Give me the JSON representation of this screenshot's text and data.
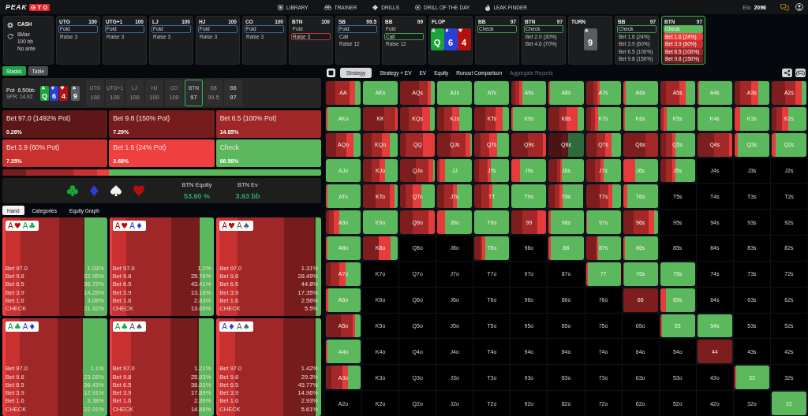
{
  "nav": {
    "logo": {
      "text": "PEAK",
      "badge": "GTO"
    },
    "links": [
      {
        "label": "LIBRARY"
      },
      {
        "label": "TRAINER"
      },
      {
        "label": "DRILLS"
      },
      {
        "label": "DRILL OF THE DAY"
      },
      {
        "label": "LEAK FINDER"
      }
    ],
    "elo": {
      "label": "Elo",
      "value": "2096"
    }
  },
  "game_info": {
    "format": "CASH",
    "details": [
      "8Max",
      "100 bb",
      "No ante"
    ]
  },
  "action_strip": [
    {
      "kind": "player",
      "position": "UTG",
      "stack": "100",
      "current": false,
      "actions": [
        {
          "label": "Fold",
          "selected": true,
          "color": "#3c6ea6"
        },
        {
          "label": "Raise 3",
          "selected": false
        }
      ]
    },
    {
      "kind": "player",
      "position": "UTG+1",
      "stack": "100",
      "current": false,
      "actions": [
        {
          "label": "Fold",
          "selected": true,
          "color": "#3c6ea6"
        },
        {
          "label": "Raise 3",
          "selected": false
        }
      ]
    },
    {
      "kind": "player",
      "position": "LJ",
      "stack": "100",
      "current": false,
      "actions": [
        {
          "label": "Fold",
          "selected": true,
          "color": "#3c6ea6"
        },
        {
          "label": "Raise 3",
          "selected": false
        }
      ]
    },
    {
      "kind": "player",
      "position": "HJ",
      "stack": "100",
      "current": false,
      "actions": [
        {
          "label": "Fold",
          "selected": true,
          "color": "#3c6ea6"
        },
        {
          "label": "Raise 3",
          "selected": false
        }
      ]
    },
    {
      "kind": "player",
      "position": "CO",
      "stack": "100",
      "current": false,
      "actions": [
        {
          "label": "Fold",
          "selected": true,
          "color": "#3c6ea6"
        },
        {
          "label": "Raise 3",
          "selected": false
        }
      ]
    },
    {
      "kind": "player",
      "position": "BTN",
      "stack": "100",
      "current": false,
      "actions": [
        {
          "label": "Fold",
          "selected": false
        },
        {
          "label": "Raise 3",
          "selected": true,
          "color": "#c23434"
        }
      ]
    },
    {
      "kind": "player",
      "position": "SB",
      "stack": "99.5",
      "current": false,
      "actions": [
        {
          "label": "Fold",
          "selected": true,
          "color": "#3c6ea6"
        },
        {
          "label": "Call",
          "selected": false
        },
        {
          "label": "Raise 12",
          "selected": false
        }
      ]
    },
    {
      "kind": "player",
      "position": "BB",
      "stack": "99",
      "current": false,
      "actions": [
        {
          "label": "Fold",
          "selected": false
        },
        {
          "label": "Call",
          "selected": true,
          "color": "#3aa34a"
        },
        {
          "label": "Raise 12",
          "selected": false
        }
      ]
    },
    {
      "kind": "street",
      "street": "FLOP",
      "cards": [
        {
          "rank": "Q",
          "suit": "♣",
          "color": "#1aa53a"
        },
        {
          "rank": "6",
          "suit": "♦",
          "color": "#2a3fd4"
        },
        {
          "rank": "4",
          "suit": "♥",
          "color": "#b30f0f"
        }
      ]
    },
    {
      "kind": "player",
      "position": "BB",
      "stack": "97",
      "current": false,
      "actions": [
        {
          "label": "Check",
          "selected": true,
          "color": "#3aa34a"
        }
      ]
    },
    {
      "kind": "player",
      "position": "BTN",
      "stack": "97",
      "current": false,
      "actions": [
        {
          "label": "Check",
          "selected": true,
          "color": "#3aa34a"
        },
        {
          "label": "Bet 2.0 (30%)",
          "selected": false
        },
        {
          "label": "Bet 4.6 (70%)",
          "selected": false
        }
      ]
    },
    {
      "kind": "street",
      "street": "TURN",
      "cards": [
        {
          "rank": "9",
          "suit": "♠",
          "color": "#5a5e63"
        }
      ]
    },
    {
      "kind": "player",
      "position": "BB",
      "stack": "97",
      "current": false,
      "actions": [
        {
          "label": "Check",
          "selected": true,
          "color": "#3aa34a"
        },
        {
          "label": "Bet 1.6 (24%)",
          "selected": false
        },
        {
          "label": "Bet 3.9 (60%)",
          "selected": false
        },
        {
          "label": "Bet 6.5 (100%)",
          "selected": false
        },
        {
          "label": "Bet 9.8 (150%)",
          "selected": false
        }
      ]
    },
    {
      "kind": "player",
      "position": "BTN",
      "stack": "97",
      "current": true,
      "actions": [
        {
          "label": "Check",
          "selected": false,
          "color": "#5cb85c"
        },
        {
          "label": "Bet 1.6 (24%)",
          "selected": false,
          "color": "#ef3f3f"
        },
        {
          "label": "Bet 3.9 (60%)",
          "selected": false,
          "color": "#c93131"
        },
        {
          "label": "Bet 6.5 (100%)",
          "selected": false,
          "color": "#a02727"
        },
        {
          "label": "Bet 9.8 (150%)",
          "selected": false,
          "color": "#7a1c1c"
        }
      ]
    }
  ],
  "panel_tabs": [
    {
      "label": "Stacks",
      "selected": true
    },
    {
      "label": "Table",
      "selected": false
    }
  ],
  "pot": {
    "label": "Pot",
    "value": "6.50bb",
    "spr": "SPR: 14.92",
    "board": [
      {
        "rank": "Q",
        "suit": "♣",
        "color": "#1aa53a"
      },
      {
        "rank": "6",
        "suit": "♦",
        "color": "#2a3fd4"
      },
      {
        "rank": "4",
        "suit": "♥",
        "color": "#b30f0f"
      },
      {
        "rank": "9",
        "suit": "♠",
        "color": "#5a5e63"
      }
    ],
    "seats": [
      {
        "position": "UTG",
        "stack": "100",
        "folded": true,
        "selected": false
      },
      {
        "position": "UTG+1",
        "stack": "100",
        "folded": true,
        "selected": false
      },
      {
        "position": "LJ",
        "stack": "100",
        "folded": true,
        "selected": false
      },
      {
        "position": "HJ",
        "stack": "100",
        "folded": true,
        "selected": false
      },
      {
        "position": "CO",
        "stack": "100",
        "folded": true,
        "selected": false
      },
      {
        "position": "BTN",
        "stack": "97",
        "folded": false,
        "selected": true
      },
      {
        "position": "SB",
        "stack": "99.5",
        "folded": true,
        "selected": false
      },
      {
        "position": "BB",
        "stack": "97",
        "folded": false,
        "selected": false
      }
    ]
  },
  "strategy": {
    "actions": [
      {
        "label": "Bet 97.0 (1492% Pot)",
        "frequency": "0.26%",
        "color": "#5e1717"
      },
      {
        "label": "Bet 9.8 (150% Pot)",
        "frequency": "7.29%",
        "color": "#771c1c"
      },
      {
        "label": "Bet 6.5 (100% Pot)",
        "frequency": "14.85%",
        "color": "#a02727"
      },
      {
        "label": "Bet 3.9 (60% Pot)",
        "frequency": "7.35%",
        "color": "#c93131"
      },
      {
        "label": "Bet 1.6 (24% Pot)",
        "frequency": "3.68%",
        "color": "#ef3f3f"
      },
      {
        "label": "Check",
        "frequency": "66.58%",
        "color": "#5cb85c"
      }
    ]
  },
  "equity": {
    "stats": [
      {
        "label": "BTN Equity",
        "value": "53.90 %"
      },
      {
        "label": "BTN Ev",
        "value": "3.93 bb"
      }
    ]
  },
  "detail_tabs": [
    {
      "label": "Hand",
      "selected": true
    },
    {
      "label": "Categories",
      "selected": false
    },
    {
      "label": "Equity Graph",
      "selected": false
    }
  ],
  "hands": [
    {
      "cards": [
        {
          "rank": "A",
          "suit": "♥",
          "color": "#b30f0f"
        },
        {
          "rank": "A",
          "suit": "♣",
          "color": "#1aa53a"
        }
      ],
      "rows": [
        {
          "label": "Bet 97.0",
          "value": "1.03%"
        },
        {
          "label": "Bet 9.8",
          "value": "22.95%"
        },
        {
          "label": "Bet 6.5",
          "value": "36.72%"
        },
        {
          "label": "Bet 3.9",
          "value": "14.29%"
        },
        {
          "label": "Bet 1.6",
          "value": "3.08%"
        },
        {
          "label": "CHECK",
          "value": "21.92%"
        }
      ]
    },
    {
      "cards": [
        {
          "rank": "A",
          "suit": "♥",
          "color": "#b30f0f"
        },
        {
          "rank": "A",
          "suit": "♦",
          "color": "#2a3fd4"
        }
      ],
      "rows": [
        {
          "label": "Bet 97.0",
          "value": "1.2%"
        },
        {
          "label": "Bet 9.8",
          "value": "25.76%"
        },
        {
          "label": "Bet 6.5",
          "value": "43.41%"
        },
        {
          "label": "Bet 3.9",
          "value": "13.16%"
        },
        {
          "label": "Bet 1.6",
          "value": "2.83%"
        },
        {
          "label": "CHECK",
          "value": "13.65%"
        }
      ]
    },
    {
      "cards": [
        {
          "rank": "A",
          "suit": "♥",
          "color": "#b30f0f"
        },
        {
          "rank": "A",
          "suit": "♠",
          "color": "#5a5e63"
        }
      ],
      "rows": [
        {
          "label": "Bet 97.0",
          "value": "1.31%"
        },
        {
          "label": "Bet 9.8",
          "value": "28.49%"
        },
        {
          "label": "Bet 6.5",
          "value": "44.8%"
        },
        {
          "label": "Bet 3.9",
          "value": "17.35%"
        },
        {
          "label": "Bet 1.6",
          "value": "2.56%"
        },
        {
          "label": "CHECK",
          "value": "5.5%"
        }
      ]
    },
    {
      "cards": [
        {
          "rank": "A",
          "suit": "♣",
          "color": "#1aa53a"
        },
        {
          "rank": "A",
          "suit": "♦",
          "color": "#2a3fd4"
        }
      ],
      "rows": [
        {
          "label": "Bet 97.0",
          "value": "1.1%"
        },
        {
          "label": "Bet 9.8",
          "value": "23.28%"
        },
        {
          "label": "Bet 6.5",
          "value": "36.43%"
        },
        {
          "label": "Bet 3.9",
          "value": "12.91%"
        },
        {
          "label": "Bet 1.6",
          "value": "3.38%"
        },
        {
          "label": "CHECK",
          "value": "22.91%"
        }
      ]
    },
    {
      "cards": [
        {
          "rank": "A",
          "suit": "♣",
          "color": "#1aa53a"
        },
        {
          "rank": "A",
          "suit": "♠",
          "color": "#5a5e63"
        }
      ],
      "rows": [
        {
          "label": "Bet 97.0",
          "value": "1.21%"
        },
        {
          "label": "Bet 9.8",
          "value": "25.93%"
        },
        {
          "label": "Bet 6.5",
          "value": "38.03%"
        },
        {
          "label": "Bet 3.9",
          "value": "17.89%"
        },
        {
          "label": "Bet 1.6",
          "value": "2.36%"
        },
        {
          "label": "CHECK",
          "value": "14.58%"
        }
      ]
    },
    {
      "cards": [
        {
          "rank": "A",
          "suit": "♦",
          "color": "#2a3fd4"
        },
        {
          "rank": "A",
          "suit": "♠",
          "color": "#5a5e63"
        }
      ],
      "rows": [
        {
          "label": "Bet 97.0",
          "value": "1.42%"
        },
        {
          "label": "Bet 9.8",
          "value": "29.3%"
        },
        {
          "label": "Bet 6.5",
          "value": "45.77%"
        },
        {
          "label": "Bet 3.9",
          "value": "14.96%"
        },
        {
          "label": "Bet 1.6",
          "value": "2.93%"
        },
        {
          "label": "CHECK",
          "value": "5.61%"
        }
      ]
    }
  ],
  "view_tabs": [
    {
      "label": "Strategy",
      "selected": true,
      "disabled": false
    },
    {
      "label": "Strategy + EV",
      "selected": false,
      "disabled": false
    },
    {
      "label": "EV",
      "selected": false,
      "disabled": false
    },
    {
      "label": "Equity",
      "selected": false,
      "disabled": false
    },
    {
      "label": "Runout Comparison",
      "selected": false,
      "disabled": false
    },
    {
      "label": "Aggregate Reports",
      "selected": false,
      "disabled": true
    }
  ],
  "range_grid": {
    "rows": [
      {
        "cells": [
          {
            "label": "AA"
          },
          {
            "label": "AKs"
          },
          {
            "label": "AQs"
          },
          {
            "label": "AJs"
          },
          {
            "label": "ATs"
          },
          {
            "label": "A9s"
          },
          {
            "label": "A8s"
          },
          {
            "label": "A7s"
          },
          {
            "label": "A6s"
          },
          {
            "label": "A5s"
          },
          {
            "label": "A4s"
          },
          {
            "label": "A3s"
          },
          {
            "label": "A2s"
          }
        ]
      },
      {
        "cells": [
          {
            "label": "AKo"
          },
          {
            "label": "KK"
          },
          {
            "label": "KQs"
          },
          {
            "label": "KJs"
          },
          {
            "label": "KTs"
          },
          {
            "label": "K9s"
          },
          {
            "label": "K8s"
          },
          {
            "label": "K7s"
          },
          {
            "label": "K6s"
          },
          {
            "label": "K5s"
          },
          {
            "label": "K4s"
          },
          {
            "label": "K3s"
          },
          {
            "label": "K2s"
          }
        ]
      },
      {
        "cells": [
          {
            "label": "AQo"
          },
          {
            "label": "KQo"
          },
          {
            "label": "QQ"
          },
          {
            "label": "QJs"
          },
          {
            "label": "QTs"
          },
          {
            "label": "Q9s"
          },
          {
            "label": "Q8s"
          },
          {
            "label": "Q7s"
          },
          {
            "label": "Q6s"
          },
          {
            "label": "Q5s"
          },
          {
            "label": "Q4s"
          },
          {
            "label": "Q3s"
          },
          {
            "label": "Q2s"
          }
        ]
      },
      {
        "cells": [
          {
            "label": "AJo"
          },
          {
            "label": "KJo"
          },
          {
            "label": "QJo"
          },
          {
            "label": "JJ"
          },
          {
            "label": "JTs"
          },
          {
            "label": "J9s"
          },
          {
            "label": "J8s"
          },
          {
            "label": "J7s"
          },
          {
            "label": "J6s"
          },
          {
            "label": "J5s"
          },
          {
            "label": "J4s"
          },
          {
            "label": "J3s"
          },
          {
            "label": "J2s"
          }
        ]
      },
      {
        "cells": [
          {
            "label": "ATo"
          },
          {
            "label": "KTo"
          },
          {
            "label": "QTo"
          },
          {
            "label": "JTo"
          },
          {
            "label": "TT"
          },
          {
            "label": "T9s"
          },
          {
            "label": "T8s"
          },
          {
            "label": "T7s"
          },
          {
            "label": "T6s"
          },
          {
            "label": "T5s"
          },
          {
            "label": "T4s"
          },
          {
            "label": "T3s"
          },
          {
            "label": "T2s"
          }
        ]
      },
      {
        "cells": [
          {
            "label": "A9o"
          },
          {
            "label": "K9o"
          },
          {
            "label": "Q9o"
          },
          {
            "label": "J9o"
          },
          {
            "label": "T9o"
          },
          {
            "label": "99"
          },
          {
            "label": "98s"
          },
          {
            "label": "97s"
          },
          {
            "label": "96s"
          },
          {
            "label": "95s"
          },
          {
            "label": "94s"
          },
          {
            "label": "93s"
          },
          {
            "label": "92s"
          }
        ]
      },
      {
        "cells": [
          {
            "label": "A8o"
          },
          {
            "label": "K8o"
          },
          {
            "label": "Q8o"
          },
          {
            "label": "J8o"
          },
          {
            "label": "T8o"
          },
          {
            "label": "98o"
          },
          {
            "label": "88"
          },
          {
            "label": "87s"
          },
          {
            "label": "86s"
          },
          {
            "label": "85s"
          },
          {
            "label": "84s"
          },
          {
            "label": "83s"
          },
          {
            "label": "82s"
          }
        ]
      },
      {
        "cells": [
          {
            "label": "A7o"
          },
          {
            "label": "K7o"
          },
          {
            "label": "Q7o"
          },
          {
            "label": "J7o"
          },
          {
            "label": "T7o"
          },
          {
            "label": "97o"
          },
          {
            "label": "87o"
          },
          {
            "label": "77"
          },
          {
            "label": "76s"
          },
          {
            "label": "75s"
          },
          {
            "label": "74s"
          },
          {
            "label": "73s"
          },
          {
            "label": "72s"
          }
        ]
      },
      {
        "cells": [
          {
            "label": "A6o"
          },
          {
            "label": "K6o"
          },
          {
            "label": "Q6o"
          },
          {
            "label": "J6o"
          },
          {
            "label": "T6o"
          },
          {
            "label": "96o"
          },
          {
            "label": "86o"
          },
          {
            "label": "76o"
          },
          {
            "label": "66"
          },
          {
            "label": "65s"
          },
          {
            "label": "64s"
          },
          {
            "label": "63s"
          },
          {
            "label": "62s"
          }
        ]
      },
      {
        "cells": [
          {
            "label": "A5o"
          },
          {
            "label": "K5o"
          },
          {
            "label": "Q5o"
          },
          {
            "label": "J5o"
          },
          {
            "label": "T5o"
          },
          {
            "label": "95o"
          },
          {
            "label": "85o"
          },
          {
            "label": "75o"
          },
          {
            "label": "65o"
          },
          {
            "label": "55"
          },
          {
            "label": "54s"
          },
          {
            "label": "53s"
          },
          {
            "label": "52s"
          }
        ]
      },
      {
        "cells": [
          {
            "label": "A4o"
          },
          {
            "label": "K4o"
          },
          {
            "label": "Q4o"
          },
          {
            "label": "J4o"
          },
          {
            "label": "T4o"
          },
          {
            "label": "94o"
          },
          {
            "label": "84o"
          },
          {
            "label": "74o"
          },
          {
            "label": "64o"
          },
          {
            "label": "54o"
          },
          {
            "label": "44"
          },
          {
            "label": "43s"
          },
          {
            "label": "42s"
          }
        ]
      },
      {
        "cells": [
          {
            "label": "A3o"
          },
          {
            "label": "K3o"
          },
          {
            "label": "Q3o"
          },
          {
            "label": "J3o"
          },
          {
            "label": "T3o"
          },
          {
            "label": "93o"
          },
          {
            "label": "83o"
          },
          {
            "label": "73o"
          },
          {
            "label": "63o"
          },
          {
            "label": "53o"
          },
          {
            "label": "43o"
          },
          {
            "label": "33"
          },
          {
            "label": "32s"
          }
        ]
      },
      {
        "cells": [
          {
            "label": "A2o"
          },
          {
            "label": "K2o"
          },
          {
            "label": "Q2o"
          },
          {
            "label": "J2o"
          },
          {
            "label": "T2o"
          },
          {
            "label": "92o"
          },
          {
            "label": "82o"
          },
          {
            "label": "72o"
          },
          {
            "label": "62o"
          },
          {
            "label": "52o"
          },
          {
            "label": "42o"
          },
          {
            "label": "32o"
          },
          {
            "label": "22"
          }
        ]
      }
    ]
  }
}
